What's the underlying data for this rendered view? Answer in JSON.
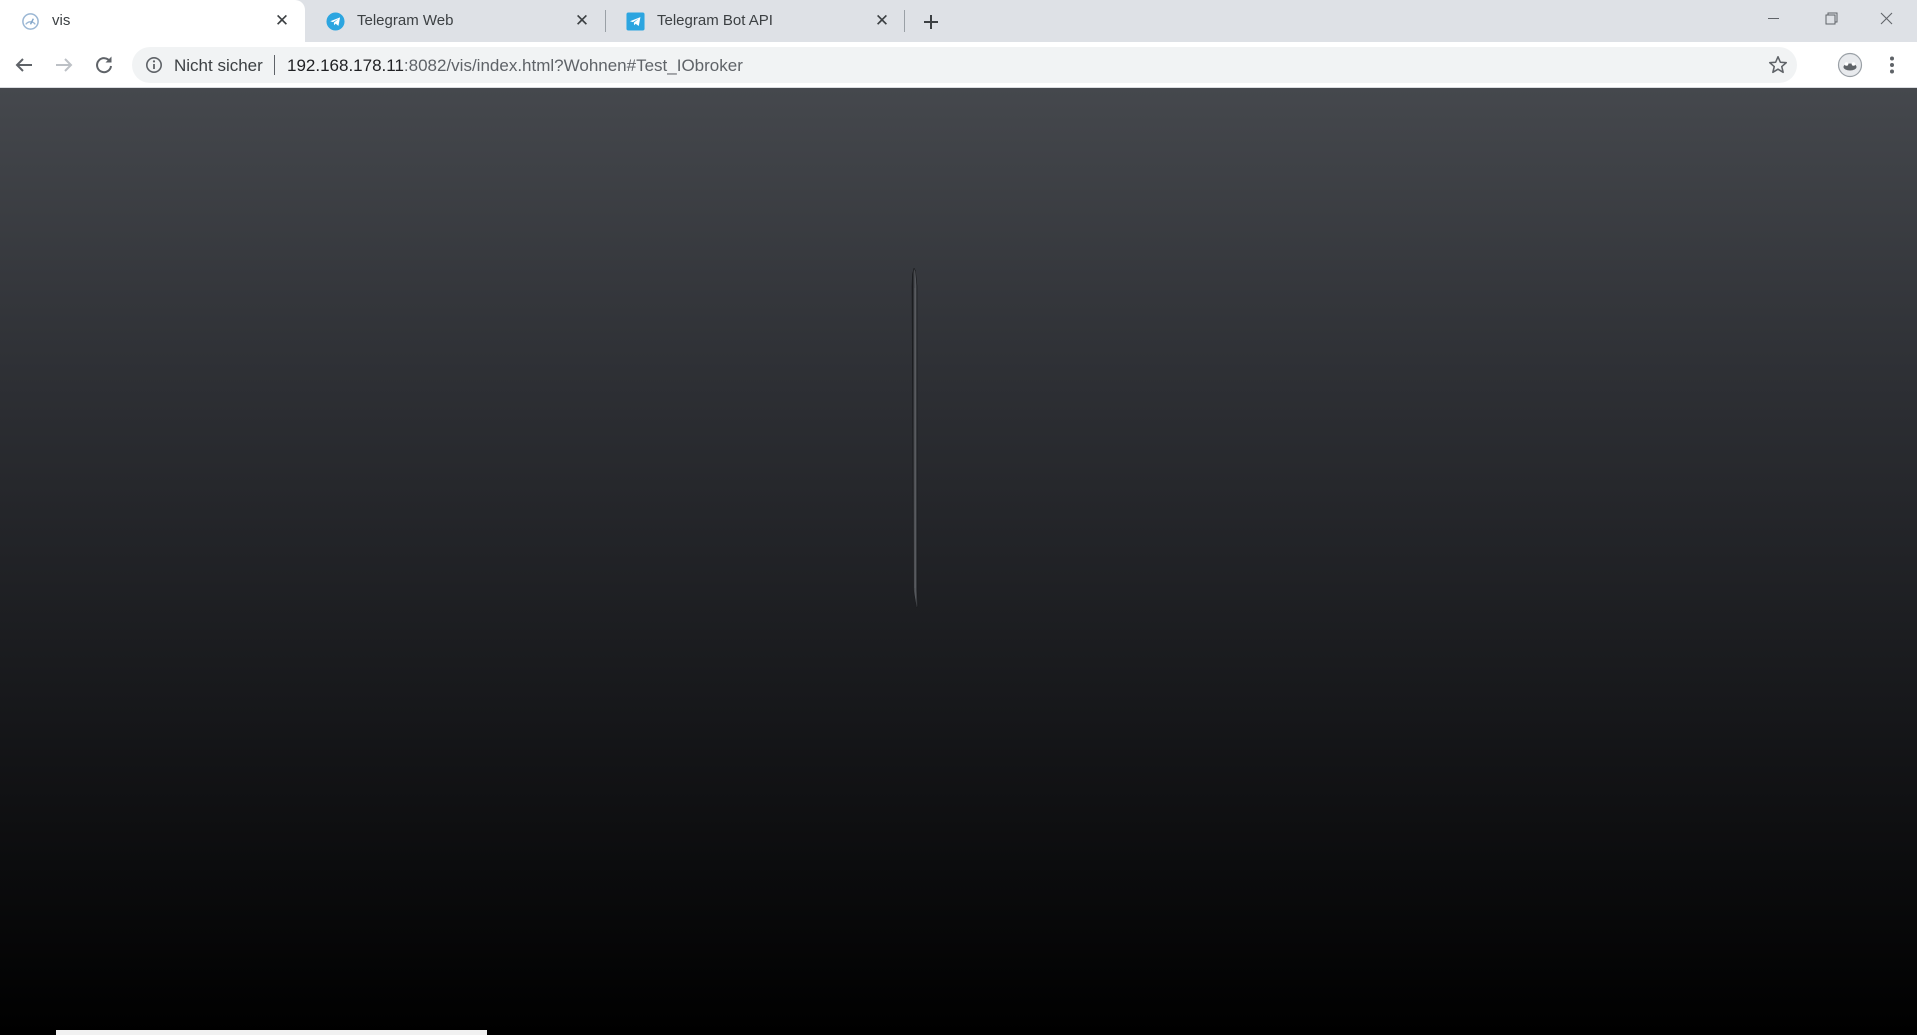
{
  "tabs": [
    {
      "title": "vis",
      "icon": "vis-gauge-icon",
      "active": true
    },
    {
      "title": "Telegram Web",
      "icon": "telegram-circle-icon",
      "active": false
    },
    {
      "title": "Telegram Bot API",
      "icon": "telegram-square-icon",
      "active": false
    }
  ],
  "toolbar": {
    "security_label": "Nicht sicher",
    "url_host": "192.168.178.11",
    "url_rest": ":8082/vis/index.html?Wohnen#Test_IObroker"
  },
  "icons": {
    "back": "arrow-left-icon",
    "forward": "arrow-right-icon",
    "reload": "reload-icon",
    "info": "info-icon",
    "bookmark": "star-icon",
    "profile": "avatar",
    "menu": "kebab-menu-icon",
    "new_tab": "plus-icon"
  },
  "colors": {
    "tabstrip": "#dee1e6",
    "active_tab": "#ffffff",
    "omnibox": "#f1f3f4",
    "telegram": "#2ca5e0",
    "page_top": "#45484d",
    "page_bottom": "#000000"
  }
}
